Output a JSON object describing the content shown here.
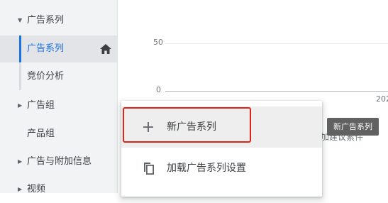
{
  "sidebar": {
    "items": [
      {
        "label": "广告系列",
        "expanded": true
      },
      {
        "label": "广告系列"
      },
      {
        "label": "竞价分析"
      },
      {
        "label": "广告组"
      },
      {
        "label": "产品组"
      },
      {
        "label": "广告与附加信息"
      },
      {
        "label": "视频"
      }
    ]
  },
  "chart": {
    "y_ticks": [
      "50",
      "0"
    ],
    "x_partial": "202"
  },
  "partial_text": "加建议素件",
  "menu": {
    "items": [
      {
        "label": "新广告系列",
        "icon": "plus-icon"
      },
      {
        "label": "加载广告系列设置",
        "icon": "copy-icon"
      }
    ]
  },
  "tooltip": "新广告系列",
  "colors": {
    "accent": "#1a73e8",
    "highlight_border": "#e2231a",
    "tooltip_bg": "#616161"
  }
}
